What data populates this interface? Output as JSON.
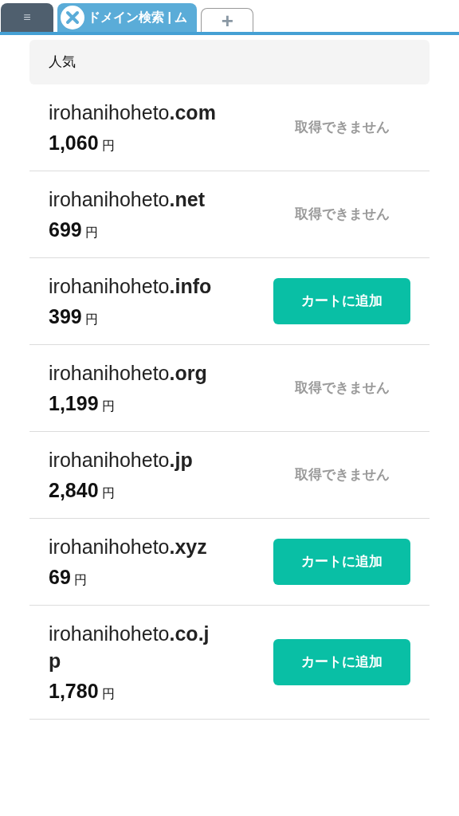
{
  "tabs": [
    {
      "kind": "menu",
      "label": "≡",
      "selected": false
    },
    {
      "kind": "page",
      "label": "ドメイン検索 | ム",
      "selected": true
    },
    {
      "kind": "new",
      "label": "+",
      "selected": false
    }
  ],
  "section": {
    "title": "人気"
  },
  "domains": [
    {
      "name": "irohanihoheto**.com**",
      "price": "1,060",
      "currency": "円",
      "kind": "unavailable",
      "status": "取得できません"
    },
    {
      "name": "irohanihoheto**.net**",
      "price": "699",
      "currency": "円",
      "kind": "unavailable",
      "status": "取得できません"
    },
    {
      "name": "irohanihoheto**.info**",
      "price": "399",
      "currency": "円",
      "kind": "available",
      "status": "カートに追加"
    },
    {
      "name": "irohanihoheto**.org**",
      "price": "1,199",
      "currency": "円",
      "kind": "unavailable",
      "status": "取得できません"
    },
    {
      "name": "irohanihoheto**.jp**",
      "price": "2,840",
      "currency": "円",
      "kind": "unavailable",
      "status": "取得できません"
    },
    {
      "name": "irohanihoheto**.xyz**",
      "price": "69",
      "currency": "円",
      "kind": "available",
      "status": "カートに追加"
    },
    {
      "name": "irohanihoheto**.co.jp**",
      "price": "1,780",
      "currency": "円",
      "kind": "available",
      "status": "カートに追加"
    }
  ]
}
